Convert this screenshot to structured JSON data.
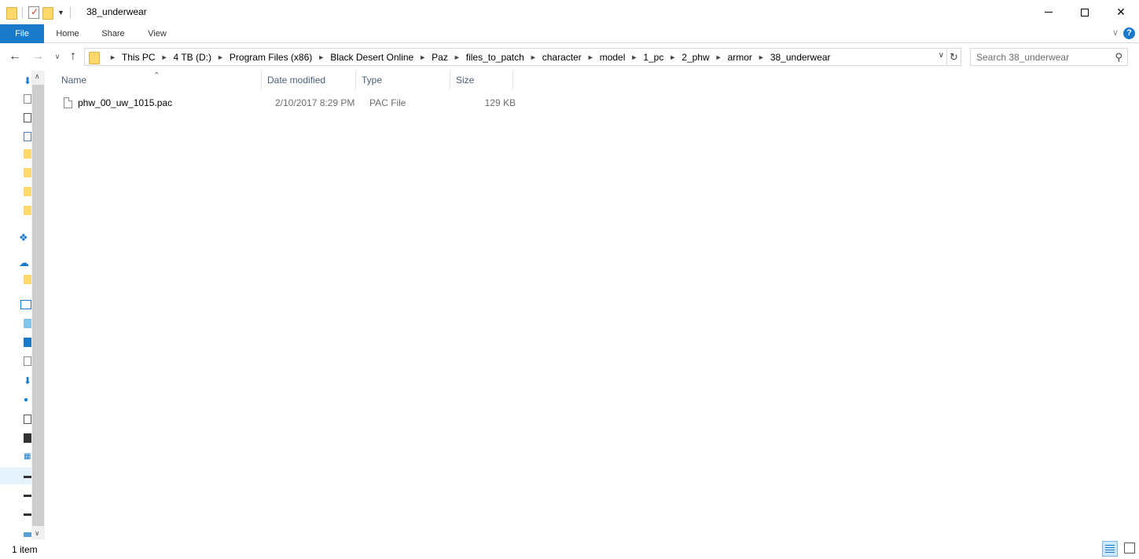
{
  "window": {
    "title": "38_underwear"
  },
  "ribbon": {
    "tabs": [
      "File",
      "Home",
      "Share",
      "View"
    ],
    "help_label": "?"
  },
  "nav": {
    "breadcrumbs": [
      "This PC",
      "4 TB (D:)",
      "Program Files (x86)",
      "Black Desert Online",
      "Paz",
      "files_to_patch",
      "character",
      "model",
      "1_pc",
      "2_phw",
      "armor",
      "38_underwear"
    ]
  },
  "search": {
    "placeholder": "Search 38_underwear"
  },
  "columns": {
    "name": "Name",
    "date": "Date modified",
    "type": "Type",
    "size": "Size"
  },
  "files": [
    {
      "name": "phw_00_uw_1015.pac",
      "date": "2/10/2017 8:29 PM",
      "type": "PAC File",
      "size": "129 KB"
    }
  ],
  "status": {
    "item_count": "1 item"
  },
  "colors": {
    "accent": "#1979ca",
    "folder": "#ffd96b",
    "header_text": "#4c607a",
    "secondary_text": "#6d6d6d"
  }
}
